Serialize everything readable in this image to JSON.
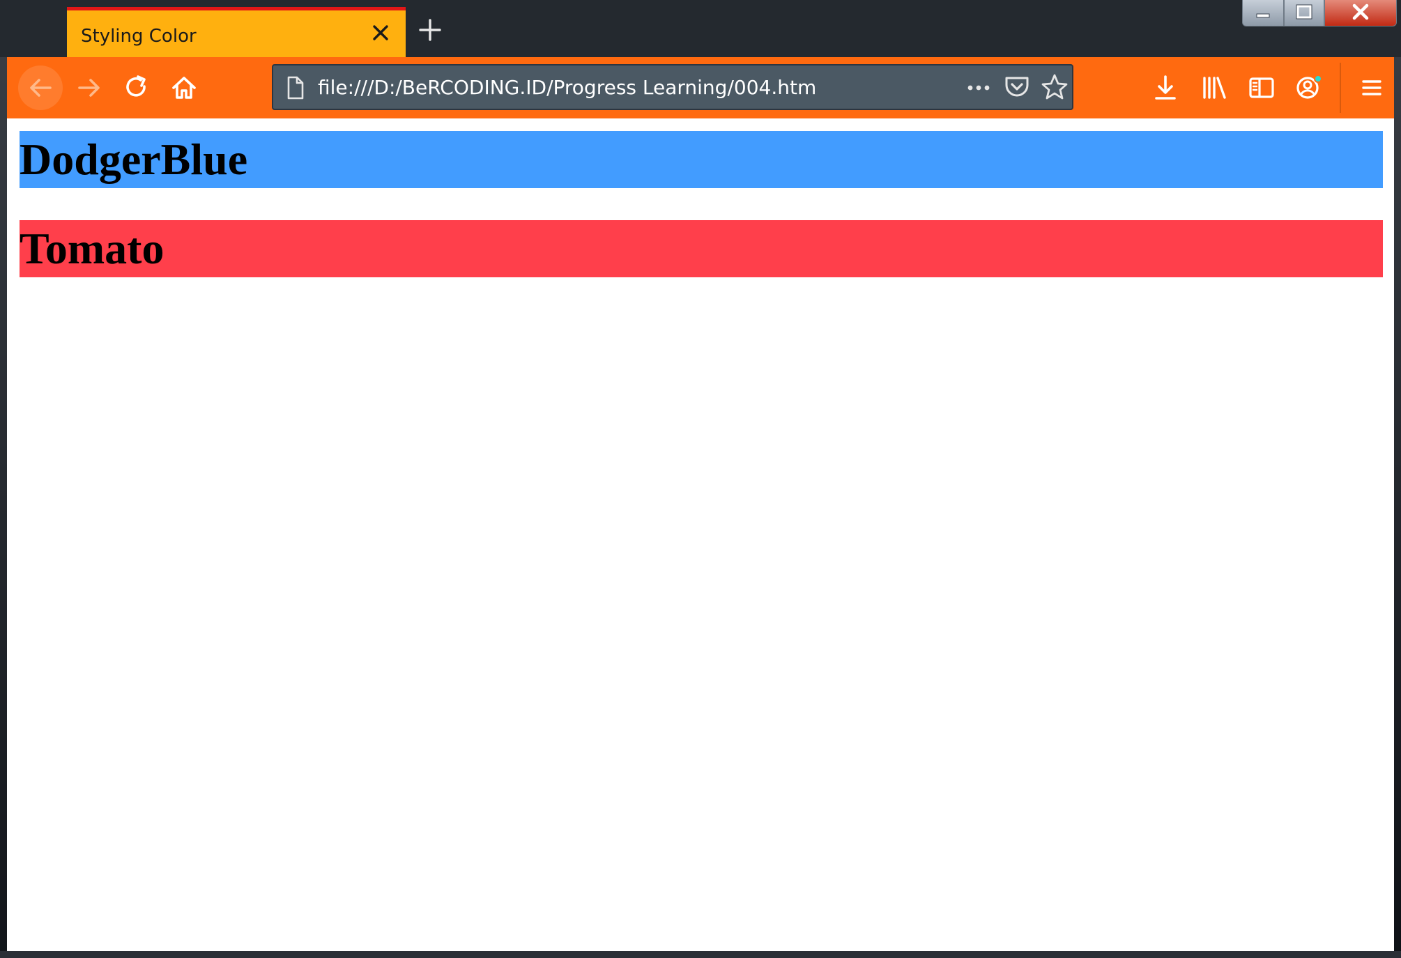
{
  "browser": {
    "tab": {
      "title": "Styling Color",
      "accent_color": "#ffb00f",
      "indicator_color": "#e21717"
    },
    "toolbar_color": "#ff6a10",
    "urlbar": {
      "url": "file:///D:/BeRCODING.ID/Progress Learning/004.htm"
    },
    "icons": {
      "tab_close": "close-icon",
      "new_tab": "plus-icon",
      "back": "arrow-left-icon",
      "forward": "arrow-right-icon",
      "reload": "reload-icon",
      "home": "home-icon",
      "page": "page-icon",
      "page_actions": "more-horizontal-icon",
      "pocket": "pocket-icon",
      "bookmark": "star-icon",
      "downloads": "download-icon",
      "library": "library-icon",
      "sidebar": "sidebar-icon",
      "account": "account-icon",
      "menu": "hamburger-icon"
    }
  },
  "page": {
    "headings": [
      {
        "text": "DodgerBlue",
        "color": "#429cff"
      },
      {
        "text": "Tomato",
        "color": "#ff3f4b"
      }
    ]
  }
}
